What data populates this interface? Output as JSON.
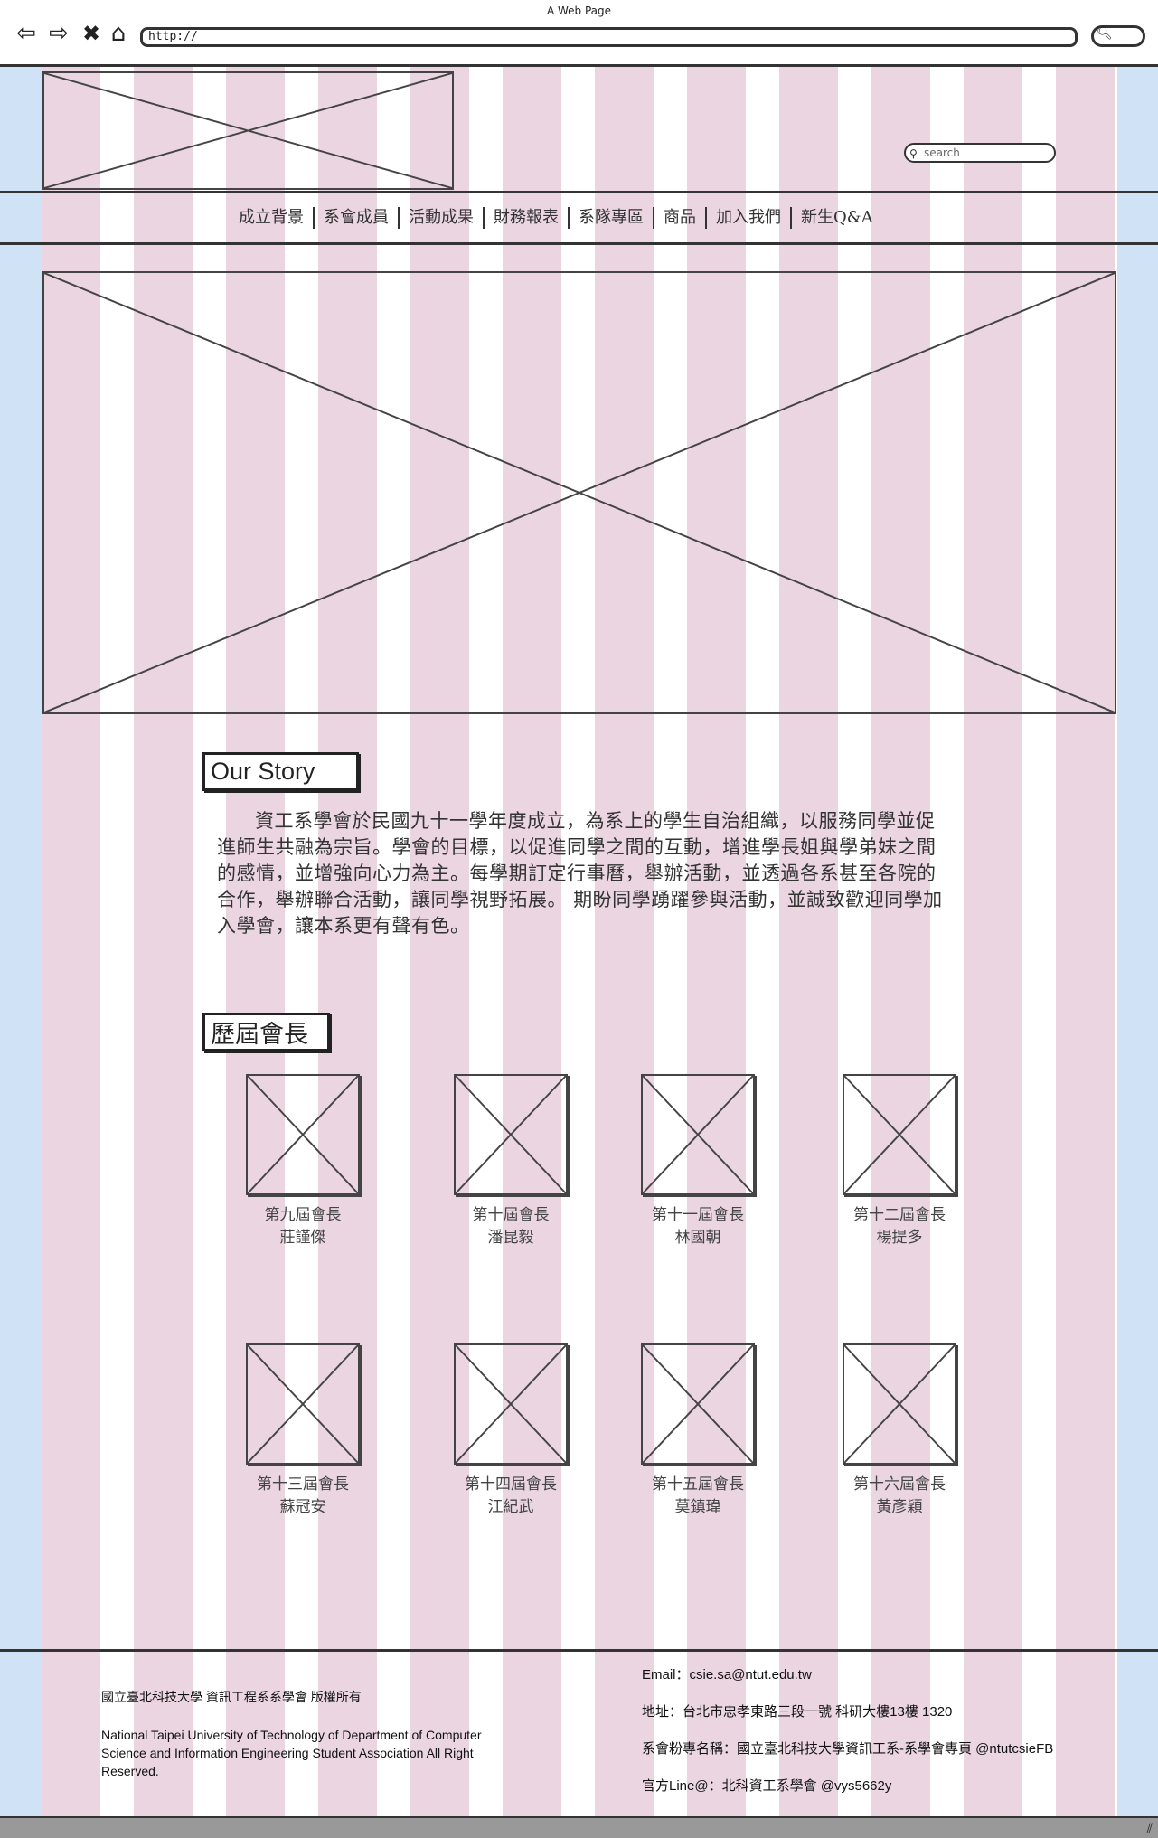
{
  "browser": {
    "window_title": "A Web Page",
    "url": "http://",
    "nav_icons": [
      "back-arrow-icon",
      "forward-arrow-icon",
      "close-x-icon",
      "home-icon"
    ]
  },
  "header": {
    "search_placeholder": "search"
  },
  "nav": {
    "items": [
      "成立背景",
      "系會成員",
      "活動成果",
      "財務報表",
      "系隊專區",
      "商品",
      "加入我們",
      "新生Q&A"
    ]
  },
  "story": {
    "title": "Our Story",
    "body": "資工系學會於民國九十一學年度成立，為系上的學生自治組織，以服務同學並促進師生共融為宗旨。學會的目標，以促進同學之間的互動，增進學長姐與學弟妹之間的感情，並增強向心力為主。每學期訂定行事曆，舉辦活動，並透過各系甚至各院的合作，舉辦聯合活動，讓同學視野拓展。 期盼同學踴躍參與活動，並誠致歡迎同學加入學會，讓本系更有聲有色。"
  },
  "presidents": {
    "title": "歷屆會長",
    "items": [
      {
        "term": "第九屆會長",
        "name": "莊謹傑"
      },
      {
        "term": "第十屆會長",
        "name": "潘昆毅"
      },
      {
        "term": "第十一屆會長",
        "name": "林國朝"
      },
      {
        "term": "第十二屆會長",
        "name": "楊提多"
      },
      {
        "term": "第十三屆會長",
        "name": "蘇冠安"
      },
      {
        "term": "第十四屆會長",
        "name": "江紀武"
      },
      {
        "term": "第十五屆會長",
        "name": "莫鎮瑋"
      },
      {
        "term": "第十六屆會長",
        "name": "黃彥穎"
      }
    ]
  },
  "footer": {
    "copyright_zh": "國立臺北科技大學 資訊工程系系學會 版權所有",
    "copyright_en": "National Taipei University of Technology of Department of Computer Science and Information Engineering Student Association All Right Reserved.",
    "email": "Email：csie.sa@ntut.edu.tw",
    "address": "地址：台北市忠孝東路三段一號 科研大樓13樓 1320",
    "facebook": "系會粉專名稱：國立臺北科技大學資訊工系-系學會專頁 @ntutcsieFB",
    "line": "官方Line@：北科資工系學會 @vys5662y"
  }
}
